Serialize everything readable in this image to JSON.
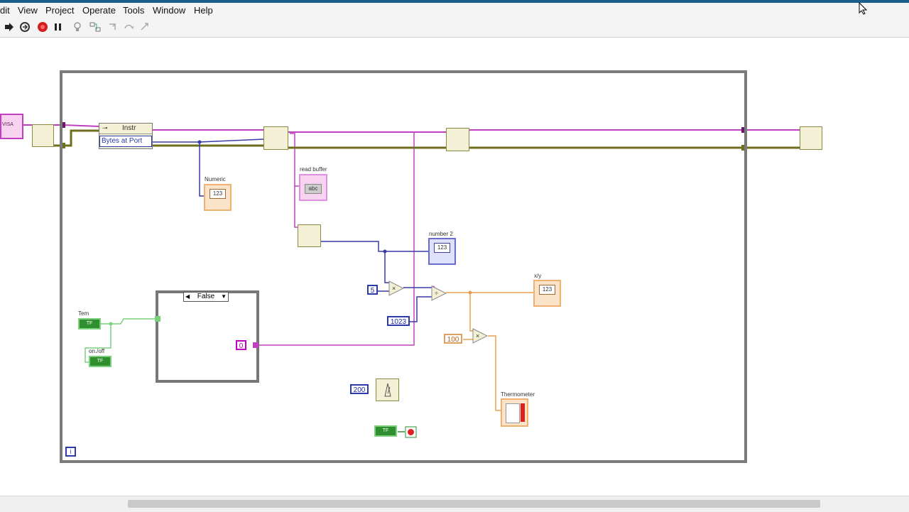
{
  "menu": [
    "dit",
    "View",
    "Project",
    "Operate",
    "Tools",
    "Window",
    "Help"
  ],
  "toolbar_icons": [
    "run-arrow-icon",
    "run-continuous-icon",
    "abort-icon",
    "pause-icon",
    "highlight-bulb-icon",
    "retain-wire-icon",
    "step-into-icon",
    "step-over-icon",
    "step-out-icon"
  ],
  "diagram": {
    "visa_prop_node": {
      "class": "Instr",
      "property": "Bytes at Port"
    },
    "visa_session_label": "VISA",
    "labels": {
      "numeric": "Numeric",
      "read_buffer": "read buffer",
      "number2": "number 2",
      "xy": "x/y",
      "thermometer": "Thermometer",
      "tem": "Tem",
      "onoff": "on./off"
    },
    "constants": {
      "five": "5",
      "c1023": "1023",
      "c100": "100",
      "c200": "200",
      "case_const": "0"
    },
    "case_selector": "False",
    "iteration_terminal": "i",
    "indicator_text": "123",
    "string_indicator_text": "abc",
    "bool_text": "TF"
  },
  "colors": {
    "titlebar": "#1b5f8a",
    "wire_visa": "#c040c0",
    "wire_error": "#6e6e1c",
    "wire_numeric_int": "#3a3aa8",
    "wire_numeric_dbl": "#e8a050",
    "wire_bool": "#2f8f2f"
  }
}
